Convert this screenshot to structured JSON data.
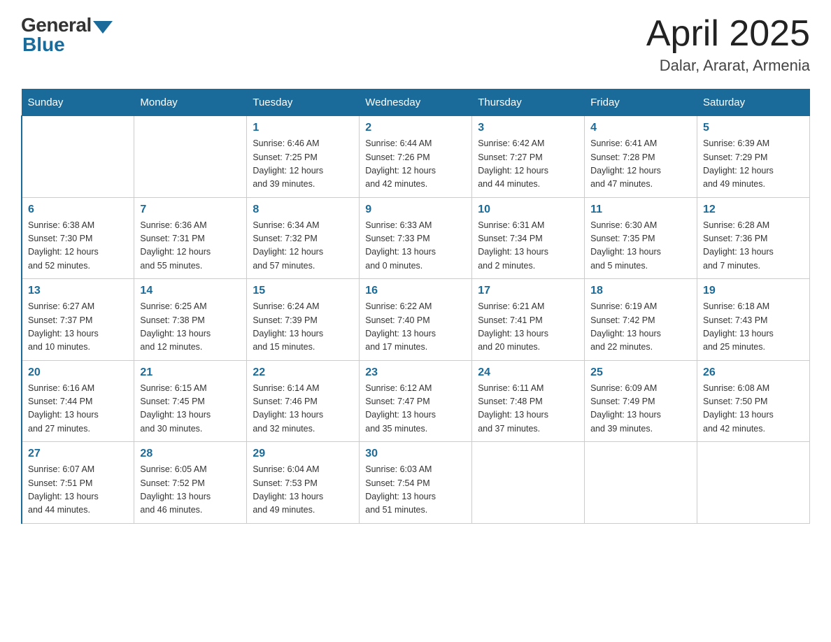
{
  "logo": {
    "general": "General",
    "blue": "Blue"
  },
  "header": {
    "month": "April 2025",
    "location": "Dalar, Ararat, Armenia"
  },
  "weekdays": [
    "Sunday",
    "Monday",
    "Tuesday",
    "Wednesday",
    "Thursday",
    "Friday",
    "Saturday"
  ],
  "weeks": [
    [
      {
        "day": "",
        "info": ""
      },
      {
        "day": "",
        "info": ""
      },
      {
        "day": "1",
        "info": "Sunrise: 6:46 AM\nSunset: 7:25 PM\nDaylight: 12 hours\nand 39 minutes."
      },
      {
        "day": "2",
        "info": "Sunrise: 6:44 AM\nSunset: 7:26 PM\nDaylight: 12 hours\nand 42 minutes."
      },
      {
        "day": "3",
        "info": "Sunrise: 6:42 AM\nSunset: 7:27 PM\nDaylight: 12 hours\nand 44 minutes."
      },
      {
        "day": "4",
        "info": "Sunrise: 6:41 AM\nSunset: 7:28 PM\nDaylight: 12 hours\nand 47 minutes."
      },
      {
        "day": "5",
        "info": "Sunrise: 6:39 AM\nSunset: 7:29 PM\nDaylight: 12 hours\nand 49 minutes."
      }
    ],
    [
      {
        "day": "6",
        "info": "Sunrise: 6:38 AM\nSunset: 7:30 PM\nDaylight: 12 hours\nand 52 minutes."
      },
      {
        "day": "7",
        "info": "Sunrise: 6:36 AM\nSunset: 7:31 PM\nDaylight: 12 hours\nand 55 minutes."
      },
      {
        "day": "8",
        "info": "Sunrise: 6:34 AM\nSunset: 7:32 PM\nDaylight: 12 hours\nand 57 minutes."
      },
      {
        "day": "9",
        "info": "Sunrise: 6:33 AM\nSunset: 7:33 PM\nDaylight: 13 hours\nand 0 minutes."
      },
      {
        "day": "10",
        "info": "Sunrise: 6:31 AM\nSunset: 7:34 PM\nDaylight: 13 hours\nand 2 minutes."
      },
      {
        "day": "11",
        "info": "Sunrise: 6:30 AM\nSunset: 7:35 PM\nDaylight: 13 hours\nand 5 minutes."
      },
      {
        "day": "12",
        "info": "Sunrise: 6:28 AM\nSunset: 7:36 PM\nDaylight: 13 hours\nand 7 minutes."
      }
    ],
    [
      {
        "day": "13",
        "info": "Sunrise: 6:27 AM\nSunset: 7:37 PM\nDaylight: 13 hours\nand 10 minutes."
      },
      {
        "day": "14",
        "info": "Sunrise: 6:25 AM\nSunset: 7:38 PM\nDaylight: 13 hours\nand 12 minutes."
      },
      {
        "day": "15",
        "info": "Sunrise: 6:24 AM\nSunset: 7:39 PM\nDaylight: 13 hours\nand 15 minutes."
      },
      {
        "day": "16",
        "info": "Sunrise: 6:22 AM\nSunset: 7:40 PM\nDaylight: 13 hours\nand 17 minutes."
      },
      {
        "day": "17",
        "info": "Sunrise: 6:21 AM\nSunset: 7:41 PM\nDaylight: 13 hours\nand 20 minutes."
      },
      {
        "day": "18",
        "info": "Sunrise: 6:19 AM\nSunset: 7:42 PM\nDaylight: 13 hours\nand 22 minutes."
      },
      {
        "day": "19",
        "info": "Sunrise: 6:18 AM\nSunset: 7:43 PM\nDaylight: 13 hours\nand 25 minutes."
      }
    ],
    [
      {
        "day": "20",
        "info": "Sunrise: 6:16 AM\nSunset: 7:44 PM\nDaylight: 13 hours\nand 27 minutes."
      },
      {
        "day": "21",
        "info": "Sunrise: 6:15 AM\nSunset: 7:45 PM\nDaylight: 13 hours\nand 30 minutes."
      },
      {
        "day": "22",
        "info": "Sunrise: 6:14 AM\nSunset: 7:46 PM\nDaylight: 13 hours\nand 32 minutes."
      },
      {
        "day": "23",
        "info": "Sunrise: 6:12 AM\nSunset: 7:47 PM\nDaylight: 13 hours\nand 35 minutes."
      },
      {
        "day": "24",
        "info": "Sunrise: 6:11 AM\nSunset: 7:48 PM\nDaylight: 13 hours\nand 37 minutes."
      },
      {
        "day": "25",
        "info": "Sunrise: 6:09 AM\nSunset: 7:49 PM\nDaylight: 13 hours\nand 39 minutes."
      },
      {
        "day": "26",
        "info": "Sunrise: 6:08 AM\nSunset: 7:50 PM\nDaylight: 13 hours\nand 42 minutes."
      }
    ],
    [
      {
        "day": "27",
        "info": "Sunrise: 6:07 AM\nSunset: 7:51 PM\nDaylight: 13 hours\nand 44 minutes."
      },
      {
        "day": "28",
        "info": "Sunrise: 6:05 AM\nSunset: 7:52 PM\nDaylight: 13 hours\nand 46 minutes."
      },
      {
        "day": "29",
        "info": "Sunrise: 6:04 AM\nSunset: 7:53 PM\nDaylight: 13 hours\nand 49 minutes."
      },
      {
        "day": "30",
        "info": "Sunrise: 6:03 AM\nSunset: 7:54 PM\nDaylight: 13 hours\nand 51 minutes."
      },
      {
        "day": "",
        "info": ""
      },
      {
        "day": "",
        "info": ""
      },
      {
        "day": "",
        "info": ""
      }
    ]
  ]
}
